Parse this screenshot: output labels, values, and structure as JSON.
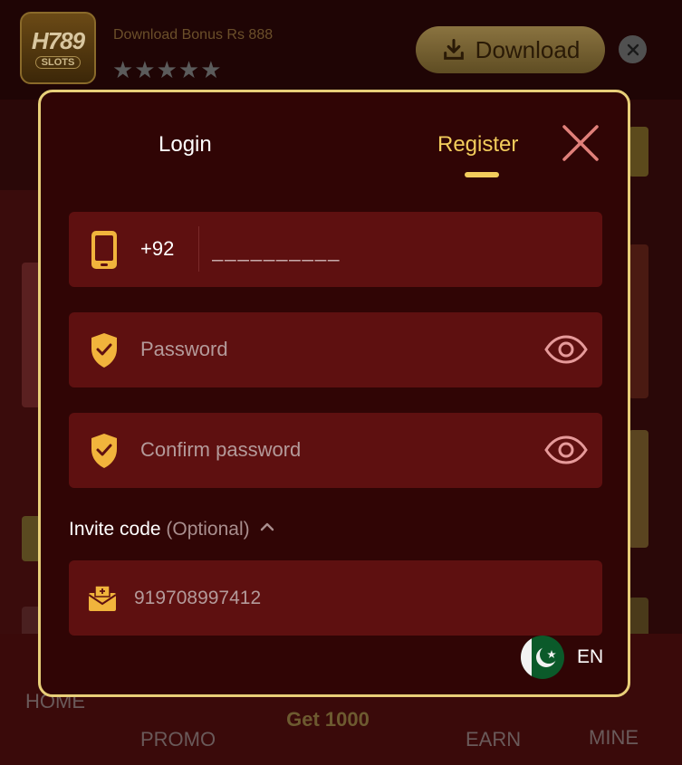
{
  "topbar": {
    "logo_line1": "H789",
    "logo_line2": "SLOTS",
    "bonus_text": "Download Bonus Rs 888",
    "stars": "★★★★★",
    "download_label": "Download"
  },
  "bottom_nav": {
    "home": "HOME",
    "promo": "PROMO",
    "center": "Get 1000",
    "earn": "EARN",
    "mine": "MINE"
  },
  "modal": {
    "tabs": {
      "login": "Login",
      "register": "Register",
      "active": "register"
    },
    "phone": {
      "country_code": "+92",
      "placeholder": "__________"
    },
    "password": {
      "placeholder": "Password"
    },
    "confirm_password": {
      "placeholder": "Confirm password"
    },
    "invite": {
      "label": "Invite code",
      "optional": "(Optional)",
      "value": "919708997412"
    },
    "language": {
      "code": "EN"
    }
  },
  "colors": {
    "accent": "#f2cd5c",
    "modal_bg": "#300505",
    "field_bg": "#5e1010",
    "border": "#e8cf79"
  }
}
